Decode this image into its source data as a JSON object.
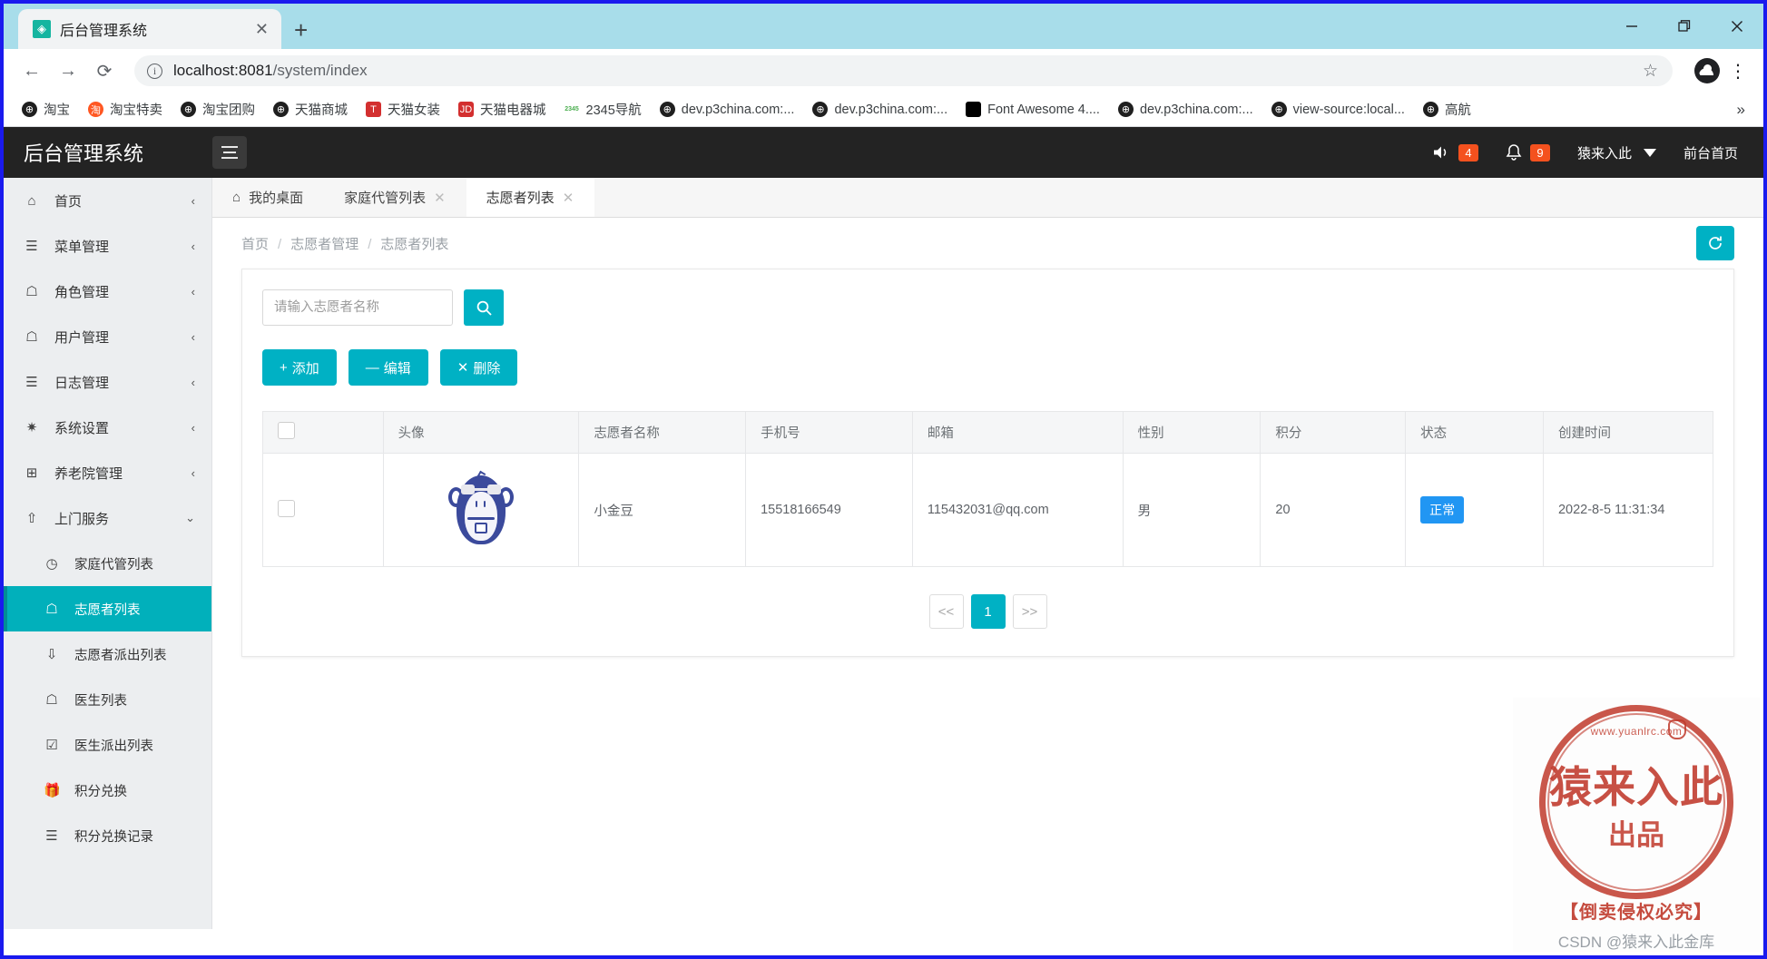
{
  "browser": {
    "tab_title": "后台管理系统",
    "tab_close": "✕",
    "newtab_label": "+",
    "minimize": "—",
    "maximize": "❐",
    "close": "✕",
    "back_icon": "←",
    "forward_icon": "→",
    "reload_icon": "⟳",
    "info_icon": "ⓘ",
    "url_host": "localhost:8081",
    "url_path": "/system/index",
    "star_icon": "☆",
    "menu_icon": "⋮",
    "bookmarks": [
      {
        "label": "淘宝",
        "icon": "globe"
      },
      {
        "label": "淘宝特卖",
        "icon": "orange"
      },
      {
        "label": "淘宝团购",
        "icon": "globe"
      },
      {
        "label": "天猫商城",
        "icon": "globe"
      },
      {
        "label": "天猫女装",
        "icon": "red",
        "glyph": "T"
      },
      {
        "label": "天猫电器城",
        "icon": "red",
        "glyph": "JD"
      },
      {
        "label": "2345导航",
        "icon": "green",
        "glyph": "2345"
      },
      {
        "label": "dev.p3china.com:...",
        "icon": "globe"
      },
      {
        "label": "dev.p3china.com:...",
        "icon": "globe"
      },
      {
        "label": "Font Awesome 4....",
        "icon": "black"
      },
      {
        "label": "dev.p3china.com:...",
        "icon": "globe"
      },
      {
        "label": "view-source:local...",
        "icon": "globe"
      },
      {
        "label": "高航",
        "icon": "globe"
      }
    ],
    "bookmarks_overflow": "»"
  },
  "app": {
    "brand": "后台管理系统",
    "hamburger_name": "menu-toggle",
    "header_right": {
      "volume_badge": "4",
      "bell_badge": "9",
      "user_name": "猿来入此",
      "front_page": "前台首页"
    },
    "sidebar": [
      {
        "label": "首页",
        "icon": "⌂",
        "arrow": "‹",
        "level": 0
      },
      {
        "label": "菜单管理",
        "icon": "☰",
        "arrow": "‹",
        "level": 0
      },
      {
        "label": "角色管理",
        "icon": "☖",
        "arrow": "‹",
        "level": 0
      },
      {
        "label": "用户管理",
        "icon": "☖",
        "arrow": "‹",
        "level": 0
      },
      {
        "label": "日志管理",
        "icon": "☰",
        "arrow": "‹",
        "level": 0
      },
      {
        "label": "系统设置",
        "icon": "✷",
        "arrow": "‹",
        "level": 0
      },
      {
        "label": "养老院管理",
        "icon": "⊞",
        "arrow": "‹",
        "level": 0
      },
      {
        "label": "上门服务",
        "icon": "⇧",
        "arrow": "⌄",
        "level": 0,
        "expanded": true
      },
      {
        "label": "家庭代管列表",
        "icon": "◷",
        "arrow": "",
        "level": 1
      },
      {
        "label": "志愿者列表",
        "icon": "☖",
        "arrow": "",
        "level": 1,
        "active": true
      },
      {
        "label": "志愿者派出列表",
        "icon": "⇩",
        "arrow": "",
        "level": 1
      },
      {
        "label": "医生列表",
        "icon": "☖",
        "arrow": "",
        "level": 1
      },
      {
        "label": "医生派出列表",
        "icon": "☑",
        "arrow": "",
        "level": 1
      },
      {
        "label": "积分兑换",
        "icon": "🎁",
        "arrow": "",
        "level": 1
      },
      {
        "label": "积分兑换记录",
        "icon": "☰",
        "arrow": "",
        "level": 1
      }
    ],
    "content_tabs": [
      {
        "label": "我的桌面",
        "home_icon": "⌂",
        "closable": false,
        "active": false
      },
      {
        "label": "家庭代管列表",
        "close": "✕",
        "closable": true,
        "active": false
      },
      {
        "label": "志愿者列表",
        "close": "✕",
        "closable": true,
        "active": true
      }
    ],
    "breadcrumb": [
      "首页",
      "志愿者管理",
      "志愿者列表"
    ],
    "breadcrumb_sep": "/",
    "refresh_icon": "⟳",
    "search": {
      "placeholder": "请输入志愿者名称",
      "value": "",
      "button_icon": "🔍"
    },
    "actions": [
      {
        "label": "添加",
        "glyph": "+"
      },
      {
        "label": "编辑",
        "glyph": "—"
      },
      {
        "label": "删除",
        "glyph": "✕"
      }
    ],
    "table": {
      "columns": [
        "",
        "头像",
        "志愿者名称",
        "手机号",
        "邮箱",
        "性别",
        "积分",
        "状态",
        "创建时间"
      ],
      "rows": [
        {
          "checked": false,
          "avatar": "monkey-avatar",
          "name": "小金豆",
          "phone": "15518166549",
          "email": "115432031@qq.com",
          "gender": "男",
          "points": "20",
          "status": "正常",
          "created": "2022-8-5 11:31:34"
        }
      ]
    },
    "pagination": {
      "prev": "<<",
      "pages": [
        "1"
      ],
      "next": ">>",
      "current": "1"
    }
  },
  "watermark": {
    "url_arc": "www.yuanlrc.com",
    "seal_main": "猿来入此",
    "seal_sub": "出品",
    "footer": "【倒卖侵权必究】",
    "csdn": "CSDN @猿来入此金库"
  },
  "colors": {
    "accent": "#00b1c4",
    "header_bg": "#232323",
    "sidebar_bg": "#eceef0",
    "badge_orange": "#f4511e",
    "status_blue": "#2196f3",
    "seal_red": "#c0392b",
    "window_border": "#1a1aee",
    "tabstrip_bg": "#a8ddea"
  }
}
